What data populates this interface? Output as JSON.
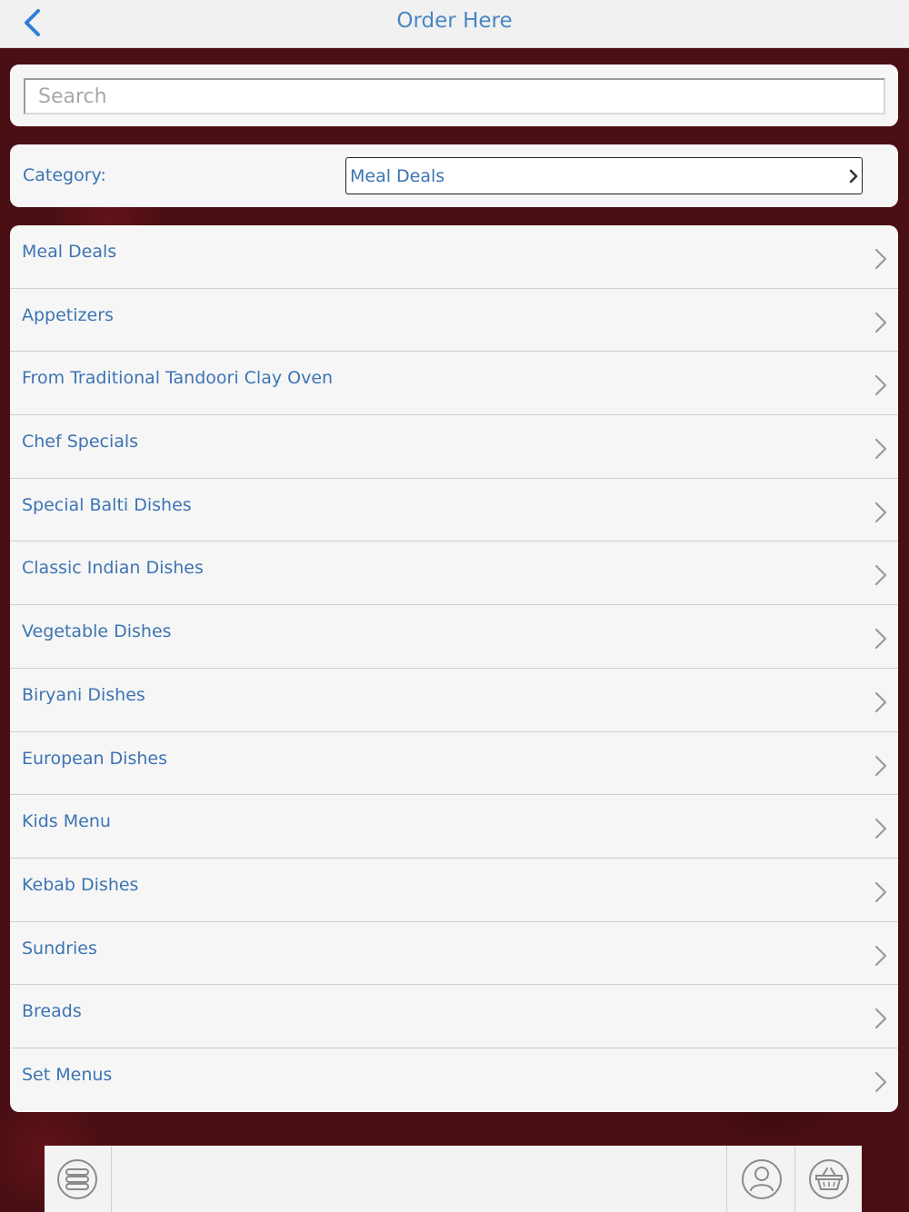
{
  "navbar": {
    "title": "Order Here",
    "accent_color": "#4a86c5"
  },
  "search": {
    "placeholder": "Search",
    "value": ""
  },
  "category": {
    "label": "Category:",
    "selected": "Meal Deals"
  },
  "menu": {
    "items": [
      {
        "label": "Meal Deals"
      },
      {
        "label": "Appetizers"
      },
      {
        "label": "From Traditional Tandoori Clay Oven"
      },
      {
        "label": "Chef Specials"
      },
      {
        "label": "Special Balti Dishes"
      },
      {
        "label": "Classic Indian Dishes"
      },
      {
        "label": "Vegetable Dishes"
      },
      {
        "label": "Biryani Dishes"
      },
      {
        "label": "European Dishes"
      },
      {
        "label": "Kids Menu"
      },
      {
        "label": "Kebab Dishes"
      },
      {
        "label": "Sundries"
      },
      {
        "label": "Breads"
      },
      {
        "label": "Set Menus"
      }
    ]
  },
  "toolbar": {
    "icons": [
      "menu-list-icon",
      "user-icon",
      "basket-icon"
    ]
  }
}
